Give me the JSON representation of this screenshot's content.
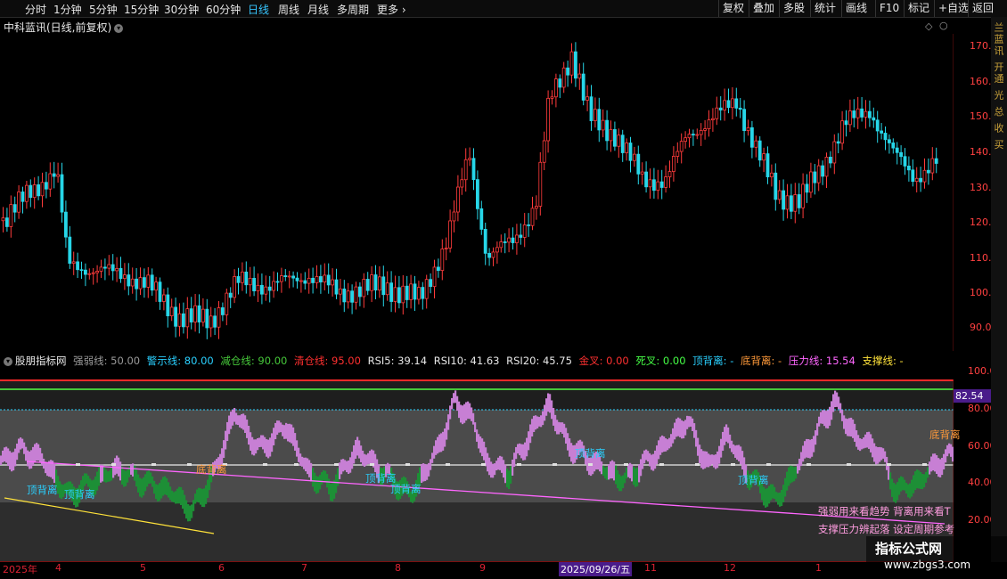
{
  "toolbar": {
    "timeframes": [
      "分时",
      "1分钟",
      "5分钟",
      "15分钟",
      "30分钟",
      "60分钟",
      "日线",
      "周线",
      "月线",
      "多周期",
      "更多"
    ],
    "active": "日线",
    "right_buttons": [
      "复权",
      "叠加",
      "多股",
      "统计",
      "画线",
      "F10",
      "标记",
      "+自选",
      "返回"
    ]
  },
  "stock": {
    "title": "中科蓝讯(日线,前复权)"
  },
  "price_axis": {
    "labels": [
      "170.0",
      "160.0",
      "150.0",
      "140.0",
      "130.0",
      "120.0",
      "110.0",
      "100.0",
      "90.00"
    ]
  },
  "indicator": {
    "name": "股朋指标网",
    "items": [
      {
        "label": "强弱线: 50.00",
        "color": "#9a9a9a"
      },
      {
        "label": "警示线: 80.00",
        "color": "#2ad0ff"
      },
      {
        "label": "减仓线: 90.00",
        "color": "#46c83a"
      },
      {
        "label": "清仓线: 95.00",
        "color": "#ff3030"
      },
      {
        "label": "RSI5: 39.14",
        "color": "#e8e8e8"
      },
      {
        "label": "RSI10: 41.63",
        "color": "#e8e8e8"
      },
      {
        "label": "RSI20: 45.75",
        "color": "#e8e8e8"
      },
      {
        "label": "金叉: 0.00",
        "color": "#ff3030"
      },
      {
        "label": "死叉: 0.00",
        "color": "#46ff46"
      },
      {
        "label": "顶背离: -",
        "color": "#2ad0ff"
      },
      {
        "label": "底背离: -",
        "color": "#ff9a3a"
      },
      {
        "label": "压力线: 15.54",
        "color": "#ff66ff"
      },
      {
        "label": "支撑线: -",
        "color": "#ffe23a"
      }
    ],
    "axis": [
      "100.0",
      "80.00",
      "60.00",
      "40.00",
      "20.00"
    ],
    "current_value": "82.54",
    "signals": {
      "top": "顶背离",
      "bottom": "底背离"
    },
    "notes": [
      "强弱用来看趋势 背离用来看T",
      "支撑压力辨起落 设定周期参考"
    ]
  },
  "dates": [
    "2025年",
    "4",
    "5",
    "6",
    "7",
    "8",
    "9",
    "2025/09/26/五",
    "11",
    "12",
    "1"
  ],
  "right_strip": "兰蓝讯 开通 光 总 收 买",
  "watermark": {
    "title": "指标公式网",
    "url": "www.zbgs3.com"
  },
  "colors": {
    "up": "#ff3b3b",
    "down": "#27d6e8",
    "bg": "#000000"
  }
}
